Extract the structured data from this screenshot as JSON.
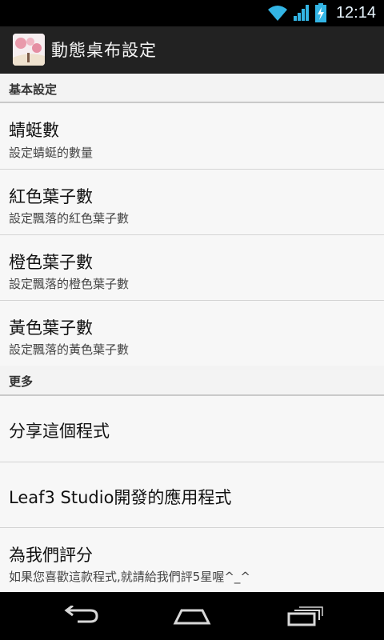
{
  "status_bar": {
    "time": "12:14",
    "icons": [
      "wifi-icon",
      "signal-icon",
      "battery-charging-icon"
    ]
  },
  "action_bar": {
    "title": "動態桌布設定",
    "app_icon": "app-icon"
  },
  "sections": {
    "basic": {
      "header": "基本設定",
      "items": [
        {
          "title": "蜻蜓數",
          "summary": "設定蜻蜓的數量"
        },
        {
          "title": "紅色葉子數",
          "summary": "設定飄落的紅色葉子數"
        },
        {
          "title": "橙色葉子數",
          "summary": "設定飄落的橙色葉子數"
        },
        {
          "title": "黃色葉子數",
          "summary": "設定飄落的黃色葉子數"
        }
      ]
    },
    "more": {
      "header": "更多",
      "items": [
        {
          "title": "分享這個程式"
        },
        {
          "title": "Leaf3 Studio開發的應用程式"
        },
        {
          "title": "為我們評分",
          "summary": "如果您喜歡這款程式,就請給我們評5星喔^_^"
        }
      ]
    }
  },
  "nav_bar": {
    "icons": [
      "back-icon",
      "home-icon",
      "recent-apps-icon"
    ]
  },
  "colors": {
    "status_bg": "#000000",
    "action_bar_bg": "#222222",
    "list_bg": "#f7f7f7",
    "divider": "#c9c9c9"
  }
}
